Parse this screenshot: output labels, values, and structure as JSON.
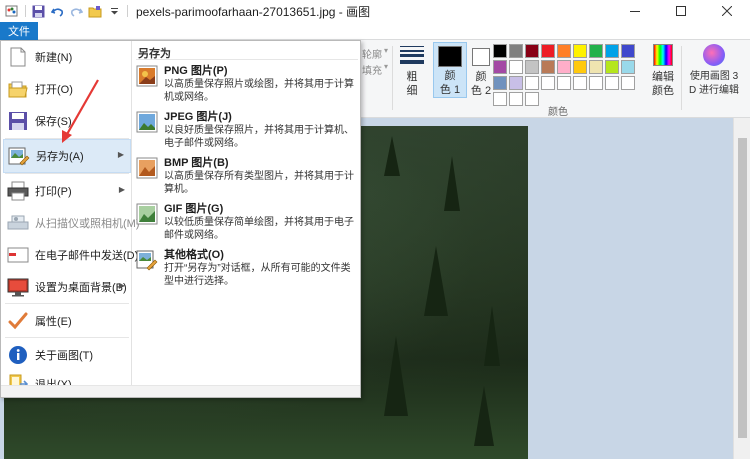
{
  "window": {
    "title": "pexels-parimoofarhaan-27013651.jpg - 画图"
  },
  "tabs": {
    "file": "文件"
  },
  "ribbon": {
    "outline_label": "轮廓",
    "fill_label": "填充",
    "thickness_label": "粗\n细",
    "color1_label": "颜\n色 1",
    "color2_label": "颜\n色 2",
    "palette": [
      "#000000",
      "#7f7f7f",
      "#880015",
      "#ed1c24",
      "#ff7f27",
      "#fff200",
      "#22b14c",
      "#00a2e8",
      "#3f48cc",
      "#a349a4",
      "#ffffff",
      "#c3c3c3",
      "#b97a57",
      "#ffaec9",
      "#ffc90e",
      "#efe4b0",
      "#b5e61d",
      "#99d9ea",
      "#7092be",
      "#c8bfe7",
      "#ffffff",
      "#ffffff",
      "#ffffff",
      "#ffffff",
      "#ffffff",
      "#ffffff",
      "#ffffff",
      "#ffffff",
      "#ffffff",
      "#ffffff"
    ],
    "color1": "#000000",
    "color2": "#ffffff",
    "edit_colors_label": "编辑\n颜色",
    "paint3d_label": "使用画图 3\nD 进行编辑",
    "colors_group_label": "颜色"
  },
  "file_menu": {
    "items": [
      {
        "label": "新建(N)",
        "icon": "new-file-icon"
      },
      {
        "label": "打开(O)",
        "icon": "open-folder-icon"
      },
      {
        "label": "保存(S)",
        "icon": "save-disk-icon"
      },
      {
        "label": "另存为(A)",
        "icon": "save-as-icon"
      },
      {
        "label": "打印(P)",
        "icon": "printer-icon"
      },
      {
        "label": "从扫描仪或照相机(M)",
        "icon": "scanner-icon"
      },
      {
        "label": "在电子邮件中发送(D)",
        "icon": "email-icon"
      },
      {
        "label": "设置为桌面背景(B)",
        "icon": "desktop-background-icon"
      },
      {
        "label": "属性(E)",
        "icon": "checkmark-icon"
      },
      {
        "label": "关于画图(T)",
        "icon": "info-icon"
      },
      {
        "label": "退出(X)",
        "icon": "exit-icon"
      }
    ],
    "saveas_header": "另存为",
    "saveas_options": [
      {
        "title": "PNG 图片(P)",
        "desc": "以高质量保存照片或绘图，并将其用于计算机或网络。",
        "icon": "png-file-icon"
      },
      {
        "title": "JPEG 图片(J)",
        "desc": "以良好质量保存照片，并将其用于计算机、电子邮件或网络。",
        "icon": "jpeg-file-icon"
      },
      {
        "title": "BMP 图片(B)",
        "desc": "以高质量保存所有类型图片，并将其用于计算机。",
        "icon": "bmp-file-icon"
      },
      {
        "title": "GIF 图片(G)",
        "desc": "以较低质量保存简单绘图，并将其用于电子邮件或网络。",
        "icon": "gif-file-icon"
      },
      {
        "title": "其他格式(O)",
        "desc": "打开“另存为”对话框，从所有可能的文件类型中进行选择。",
        "icon": "other-format-icon"
      }
    ]
  },
  "colors": {
    "accent": "#1979ca",
    "menu_hover": "#dceaf7",
    "annotation": "#e53935"
  }
}
